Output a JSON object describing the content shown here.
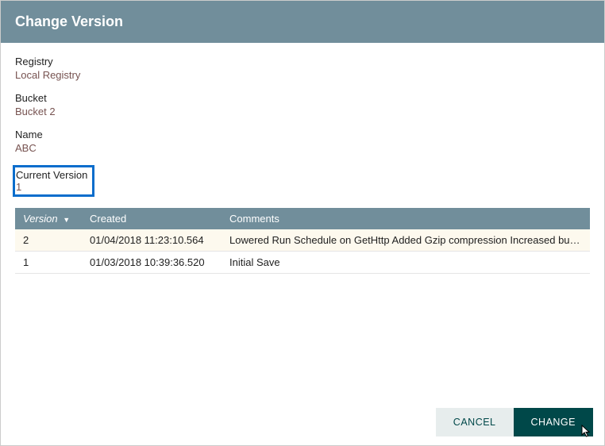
{
  "dialog": {
    "title": "Change Version"
  },
  "fields": {
    "registry_label": "Registry",
    "registry_value": "Local Registry",
    "bucket_label": "Bucket",
    "bucket_value": "Bucket 2",
    "name_label": "Name",
    "name_value": "ABC",
    "current_version_label": "Current Version",
    "current_version_value": "1"
  },
  "table": {
    "headers": {
      "version": "Version",
      "created": "Created",
      "comments": "Comments"
    },
    "rows": [
      {
        "version": "2",
        "created": "01/04/2018 11:23:10.564",
        "comments": "Lowered Run Schedule on GetHttp Added Gzip compression Increased bulletin leve…",
        "selected": true
      },
      {
        "version": "1",
        "created": "01/03/2018 10:39:36.520",
        "comments": "Initial Save",
        "selected": false
      }
    ]
  },
  "buttons": {
    "cancel": "CANCEL",
    "change": "CHANGE"
  }
}
